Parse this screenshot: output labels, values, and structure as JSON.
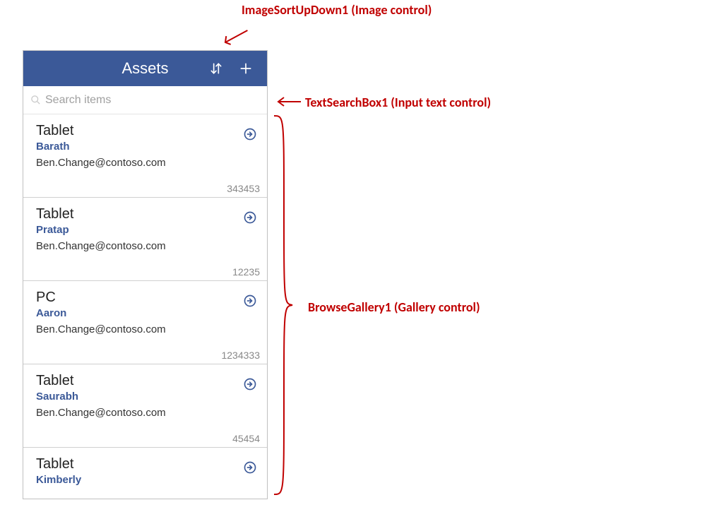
{
  "appbar": {
    "title": "Assets"
  },
  "search": {
    "placeholder": "Search items",
    "value": ""
  },
  "gallery": {
    "items": [
      {
        "title": "Tablet",
        "subtitle": "Barath",
        "email": "Ben.Change@contoso.com",
        "number": "343453"
      },
      {
        "title": "Tablet",
        "subtitle": "Pratap",
        "email": "Ben.Change@contoso.com",
        "number": "12235"
      },
      {
        "title": "PC",
        "subtitle": "Aaron",
        "email": "Ben.Change@contoso.com",
        "number": "1234333"
      },
      {
        "title": "Tablet",
        "subtitle": "Saurabh",
        "email": "Ben.Change@contoso.com",
        "number": "45454"
      },
      {
        "title": "Tablet",
        "subtitle": "Kimberly",
        "email": "",
        "number": ""
      }
    ]
  },
  "annotations": {
    "sort": "ImageSortUpDown1 (Image control)",
    "search": "TextSearchBox1 (Input text control)",
    "gallery": "BrowseGallery1 (Gallery control)"
  },
  "colors": {
    "accent": "#3b5998",
    "annotation": "#c00000"
  }
}
